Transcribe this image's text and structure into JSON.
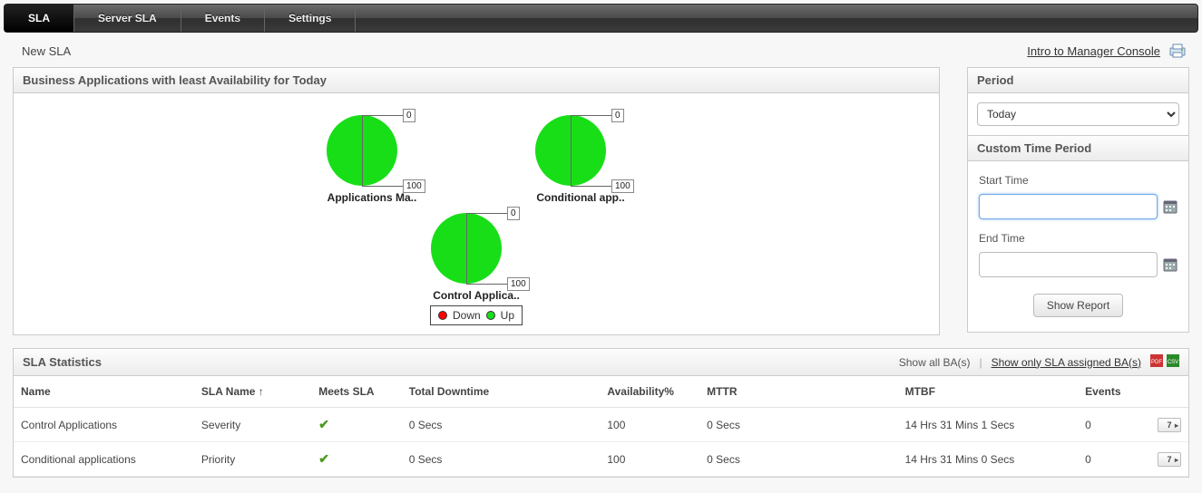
{
  "nav": {
    "tabs": [
      {
        "label": "SLA",
        "active": true
      },
      {
        "label": "Server SLA",
        "active": false
      },
      {
        "label": "Events",
        "active": false
      },
      {
        "label": "Settings",
        "active": false
      }
    ]
  },
  "subheader": {
    "left": "New SLA",
    "intro_link": "Intro to Manager Console"
  },
  "availability_panel": {
    "title": "Business Applications with least Availability for Today",
    "charts": [
      {
        "name": "Applications Ma..",
        "up": 100,
        "down": 0
      },
      {
        "name": "Conditional app..",
        "up": 100,
        "down": 0
      },
      {
        "name": "Control Applica..",
        "up": 100,
        "down": 0
      }
    ],
    "legend": {
      "down": "Down",
      "up": "Up"
    }
  },
  "period_panel": {
    "title": "Period",
    "selected": "Today",
    "custom_title": "Custom Time Period",
    "start_label": "Start Time",
    "end_label": "End Time",
    "start_value": "",
    "end_value": "",
    "show_report": "Show Report"
  },
  "stats_panel": {
    "title": "SLA Statistics",
    "show_all": "Show all BA(s)",
    "show_sla_only": "Show only SLA assigned BA(s)",
    "columns": [
      "Name",
      "SLA Name ↑",
      "Meets SLA",
      "Total Downtime",
      "Availability%",
      "MTTR",
      "MTBF",
      "Events",
      ""
    ],
    "rows": [
      {
        "name": "Control Applications",
        "sla": "Severity",
        "meets": true,
        "downtime": "0 Secs",
        "avail": "100",
        "mttr": "0 Secs",
        "mtbf": "14 Hrs 31 Mins 1 Secs",
        "events": "0",
        "action": "7"
      },
      {
        "name": "Conditional applications",
        "sla": "Priority",
        "meets": true,
        "downtime": "0 Secs",
        "avail": "100",
        "mttr": "0 Secs",
        "mtbf": "14 Hrs 31 Mins 0 Secs",
        "events": "0",
        "action": "7"
      }
    ]
  },
  "chart_data": [
    {
      "type": "pie",
      "title": "Applications Ma..",
      "series": [
        {
          "name": "Down",
          "value": 0
        },
        {
          "name": "Up",
          "value": 100
        }
      ]
    },
    {
      "type": "pie",
      "title": "Conditional app..",
      "series": [
        {
          "name": "Down",
          "value": 0
        },
        {
          "name": "Up",
          "value": 100
        }
      ]
    },
    {
      "type": "pie",
      "title": "Control Applica..",
      "series": [
        {
          "name": "Down",
          "value": 0
        },
        {
          "name": "Up",
          "value": 100
        }
      ]
    }
  ]
}
